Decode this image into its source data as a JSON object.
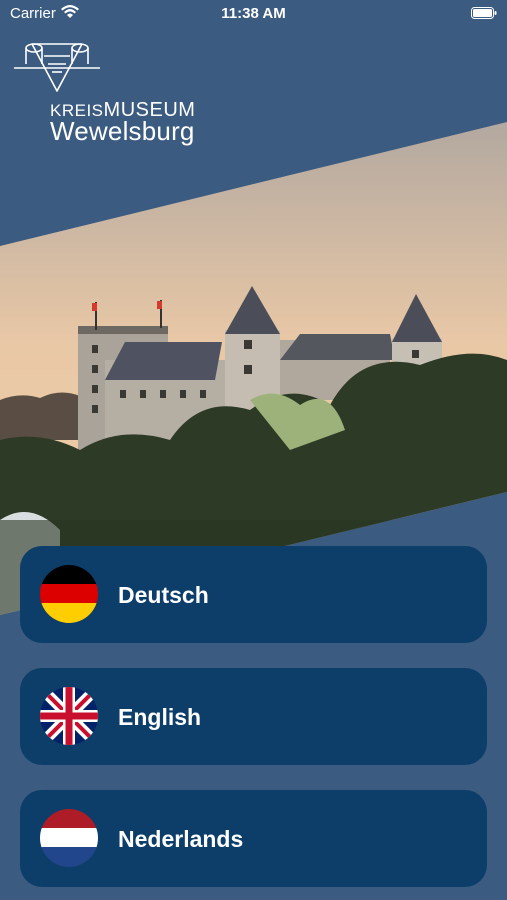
{
  "status_bar": {
    "carrier": "Carrier",
    "time": "11:38 AM",
    "wifi_icon": "wifi-icon",
    "battery_icon": "battery-icon"
  },
  "brand": {
    "line1_prefix": "KREIS",
    "line1_main": "MUSEUM",
    "line2": "Wewelsburg",
    "logo_icon": "castle-triangle-logo"
  },
  "hero": {
    "image": "wewelsburg-castle-photo"
  },
  "languages": [
    {
      "label": "Deutsch",
      "flag": "germany-flag-icon"
    },
    {
      "label": "English",
      "flag": "uk-flag-icon"
    },
    {
      "label": "Nederlands",
      "flag": "netherlands-flag-icon"
    }
  ],
  "colors": {
    "background": "#3b5b81",
    "button": "#0d3e6a",
    "text": "#ffffff"
  }
}
